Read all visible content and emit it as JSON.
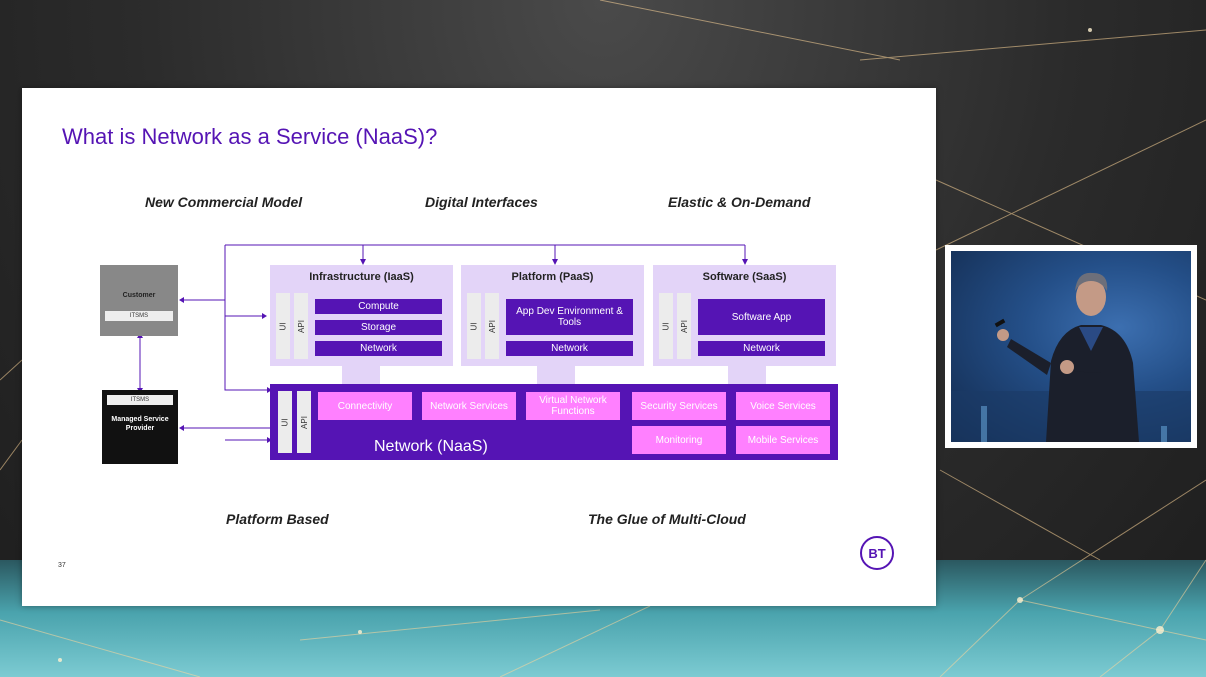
{
  "slide": {
    "title": "What is Network as a Service (NaaS)?",
    "headings": {
      "commercial": "New Commercial Model",
      "digital": "Digital Interfaces",
      "elastic": "Elastic & On-Demand",
      "platform": "Platform Based",
      "glue": "The Glue of Multi-Cloud"
    },
    "page_number": "37",
    "logo_text": "BT"
  },
  "diagram": {
    "customer": {
      "title": "Customer",
      "tag": "ITSMS"
    },
    "msp": {
      "tag": "ITSMS",
      "title": "Managed Service Provider"
    },
    "ui_label": "UI",
    "api_label": "API",
    "iaas": {
      "title": "Infrastructure (IaaS)",
      "items": [
        "Compute",
        "Storage",
        "Network"
      ]
    },
    "paas": {
      "title": "Platform (PaaS)",
      "items": [
        "App Dev Environment & Tools",
        "Network"
      ]
    },
    "saas": {
      "title": "Software (SaaS)",
      "items": [
        "Software App",
        "Network"
      ]
    },
    "naas": {
      "title": "Network (NaaS)",
      "services": [
        "Connectivity",
        "Network Services",
        "Virtual Network Functions",
        "Security Services",
        "Voice Services",
        "Monitoring",
        "Mobile Services"
      ]
    }
  },
  "colors": {
    "bt_purple": "#5514b4",
    "light_purple": "#e3d4f8",
    "pink": "#ff80ff",
    "customer_grey": "#888888",
    "msp_black": "#111111"
  }
}
